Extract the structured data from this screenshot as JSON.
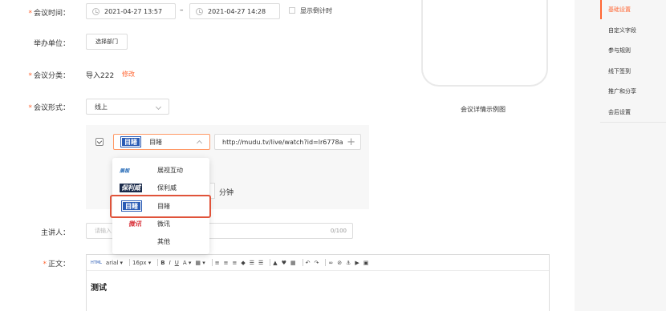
{
  "form": {
    "time": {
      "label": "会议时间：",
      "start": "2021-04-27 13:57",
      "separator": "–",
      "end": "2021-04-27 14:28",
      "countdown_label": "显示倒计时"
    },
    "host_org": {
      "label": "举办单位：",
      "button": "选择部门"
    },
    "category": {
      "label": "会议分类：",
      "value": "导入222",
      "edit": "修改"
    },
    "format": {
      "label": "会议形式：",
      "value": "线上",
      "platform_selected": "目睹",
      "url": "http://mudu.tv/live/watch?id=lr6778a",
      "minutes": "分钟"
    },
    "speaker": {
      "label": "主讲人：",
      "placeholder": "请输入",
      "counter": "0/100"
    },
    "body": {
      "label": "正文：",
      "content": "测试"
    }
  },
  "dropdown": {
    "items": [
      {
        "logo": "展视",
        "label": "展视互动"
      },
      {
        "logo": "保利威",
        "label": "保利威"
      },
      {
        "logo": "目睹",
        "label": "目睹"
      },
      {
        "logo": "微讯",
        "label": "微讯"
      },
      {
        "logo": "",
        "label": "其他"
      }
    ]
  },
  "editor": {
    "html_tag": "HTML",
    "font": "arial",
    "size": "16px"
  },
  "preview": {
    "caption": "会议详情示例图"
  },
  "nav": {
    "items": [
      "基础设置",
      "自定义字段",
      "参与规则",
      "线下签到",
      "推广和分享",
      "会后设置"
    ],
    "active_index": 0
  },
  "colors": {
    "accent": "#ff6633",
    "mudu_blue": "#2a5bb5",
    "highlight": "#e0533a"
  }
}
